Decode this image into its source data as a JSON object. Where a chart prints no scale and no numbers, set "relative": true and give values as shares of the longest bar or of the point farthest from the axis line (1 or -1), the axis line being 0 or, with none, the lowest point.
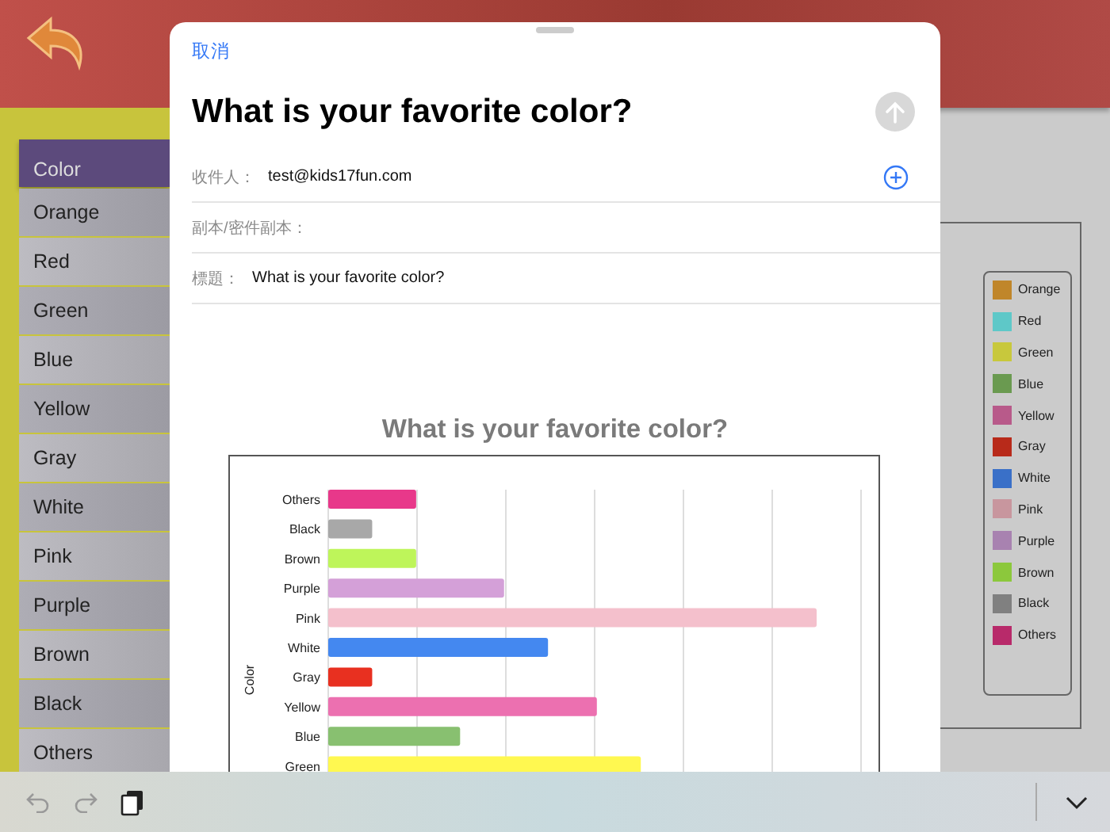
{
  "sidebar": {
    "items": [
      {
        "label": "Color",
        "kind": "header"
      },
      {
        "label": "Orange",
        "kind": "item"
      },
      {
        "label": "Red",
        "kind": "item"
      },
      {
        "label": "Green",
        "kind": "item"
      },
      {
        "label": "Blue",
        "kind": "item"
      },
      {
        "label": "Yellow",
        "kind": "item"
      },
      {
        "label": "Gray",
        "kind": "item"
      },
      {
        "label": "White",
        "kind": "item"
      },
      {
        "label": "Pink",
        "kind": "item"
      },
      {
        "label": "Purple",
        "kind": "item"
      },
      {
        "label": "Brown",
        "kind": "item"
      },
      {
        "label": "Black",
        "kind": "item"
      },
      {
        "label": "Others",
        "kind": "item"
      }
    ]
  },
  "legend": [
    {
      "label": "Orange",
      "color": "#c0862a"
    },
    {
      "label": "Red",
      "color": "#5ec8c8"
    },
    {
      "label": "Green",
      "color": "#c8c83c"
    },
    {
      "label": "Blue",
      "color": "#6a9a50"
    },
    {
      "label": "Yellow",
      "color": "#b85a8a"
    },
    {
      "label": "Gray",
      "color": "#b82a1a"
    },
    {
      "label": "White",
      "color": "#3a70c8"
    },
    {
      "label": "Pink",
      "color": "#c8969e"
    },
    {
      "label": "Purple",
      "color": "#a882b0"
    },
    {
      "label": "Brown",
      "color": "#8cc83c"
    },
    {
      "label": "Black",
      "color": "#808080"
    },
    {
      "label": "Others",
      "color": "#b82a6a"
    }
  ],
  "mail": {
    "cancel": "取消",
    "title": "What is your favorite color?",
    "fields": [
      {
        "label": "收件人：",
        "value": "test@kids17fun.com",
        "add": true
      },
      {
        "label": "副本/密件副本：",
        "add": false
      },
      {
        "label": "標題：",
        "value": "What is your favorite color?",
        "add": false
      }
    ],
    "chart_title": "What is your favorite color?",
    "chart_data": {
      "type": "bar",
      "orientation": "horizontal",
      "ylabel": "Color",
      "relative": true,
      "categories": [
        "Others",
        "Black",
        "Brown",
        "Purple",
        "Pink",
        "White",
        "Gray",
        "Yellow",
        "Blue",
        "Green"
      ],
      "series": [
        {
          "color": "#e8388a",
          "values": [
            0.18,
            null,
            null,
            null,
            null,
            null,
            null,
            null,
            null,
            null
          ]
        },
        {
          "color": "#a8a8a8",
          "values": [
            null,
            0.09,
            null,
            null,
            null,
            null,
            null,
            null,
            null,
            null
          ]
        },
        {
          "color": "#bef55a",
          "values": [
            null,
            null,
            0.18,
            null,
            null,
            null,
            null,
            null,
            null,
            null
          ]
        },
        {
          "color": "#d4a0d8",
          "values": [
            null,
            null,
            null,
            0.36,
            null,
            null,
            null,
            null,
            null,
            null
          ]
        },
        {
          "color": "#f4c0cc",
          "values": [
            null,
            null,
            null,
            null,
            1,
            null,
            null,
            null,
            null,
            null
          ]
        },
        {
          "color": "#4488f0",
          "values": [
            null,
            null,
            null,
            null,
            null,
            0.45,
            null,
            null,
            null,
            null
          ]
        },
        {
          "color": "#e83020",
          "values": [
            null,
            null,
            null,
            null,
            null,
            null,
            0.09,
            null,
            null,
            null
          ]
        },
        {
          "color": "#ec70b0",
          "values": [
            null,
            null,
            null,
            null,
            null,
            null,
            null,
            0.55,
            null,
            null
          ]
        },
        {
          "color": "#88c070",
          "values": [
            null,
            null,
            null,
            null,
            null,
            null,
            null,
            null,
            0.27,
            null
          ]
        },
        {
          "color": "#fff850",
          "values": [
            null,
            null,
            null,
            null,
            null,
            null,
            null,
            null,
            null,
            0.64
          ]
        }
      ]
    }
  }
}
